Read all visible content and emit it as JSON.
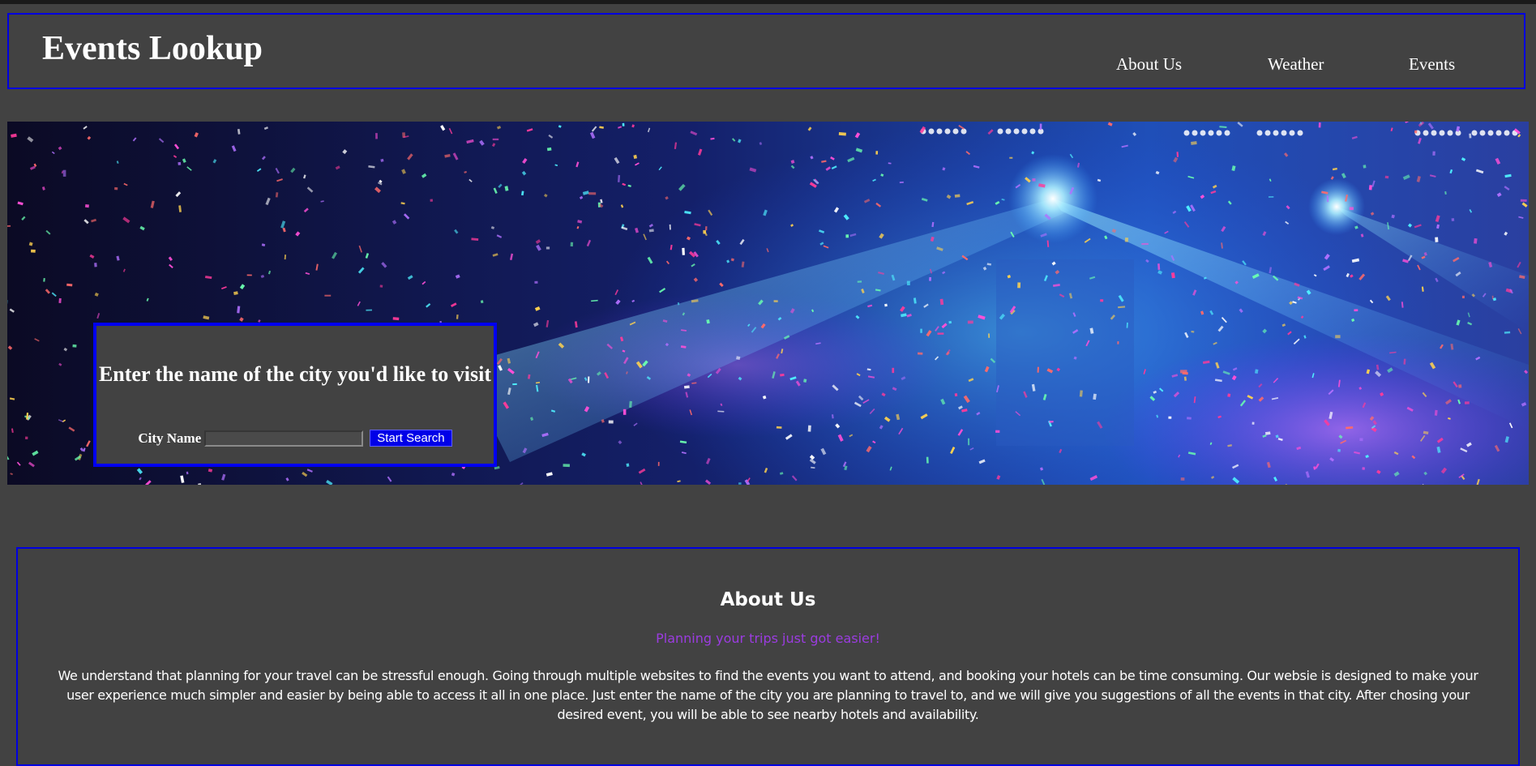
{
  "header": {
    "title": "Events Lookup",
    "nav": [
      "About Us",
      "Weather",
      "Events"
    ]
  },
  "hero": {
    "image": "concert-confetti-stage-lights",
    "search": {
      "heading": "Enter the name of the city you'd like to visit",
      "label": "City Name",
      "input_value": "",
      "button_label": "Start Search"
    }
  },
  "about": {
    "title": "About Us",
    "tagline": "Planning your trips just got easier!",
    "body": "We understand that planning for your travel can be stressful enough. Going through multiple websites to find the events you want to attend, and booking your hotels can be time consuming. Our websie is designed to make your user experience much simpler and easier by being able to access it all in one place. Just enter the name of the city you are planning to travel to, and we will give you suggestions of all the events in that city. After chosing your desired event, you will be able to see nearby hotels and availability."
  },
  "colors": {
    "background": "#424242",
    "border_accent": "#0000e0",
    "button": "#0000e8",
    "tagline": "#9b3ce0"
  }
}
